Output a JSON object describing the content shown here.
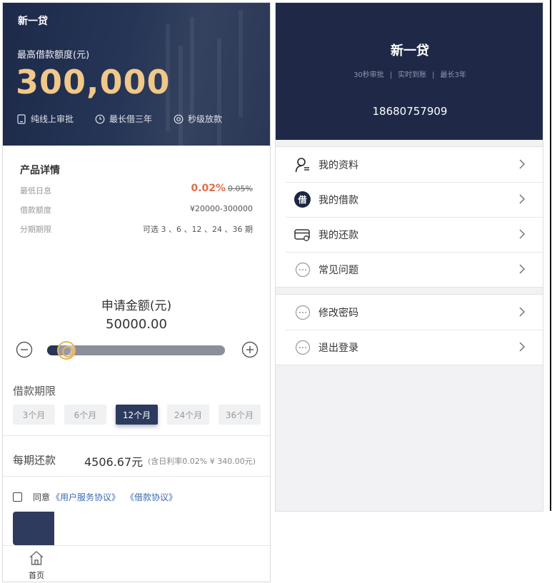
{
  "left": {
    "app_title": "新一贷",
    "limit_label": "最高借款额度(元)",
    "limit_amount": "300,000",
    "features": [
      "纯线上审批",
      "最长借三年",
      "秒级放款"
    ],
    "details": {
      "title": "产品详情",
      "rows": [
        {
          "label": "最低日息",
          "rate": "0.02%",
          "old_rate": "0.05%"
        },
        {
          "label": "借款额度",
          "value": "¥20000-300000"
        },
        {
          "label": "分期期限",
          "value": "可选 3 、6 、12 、24 、36 期"
        }
      ]
    },
    "apply": {
      "label": "申请金额(元)",
      "amount": "50000.00",
      "slider_fraction": 0.11
    },
    "term": {
      "label": "借款期限",
      "options": [
        "3个月",
        "6个月",
        "12个月",
        "24个月",
        "36个月"
      ],
      "selected": "12个月"
    },
    "repayment": {
      "label": "每期还款",
      "amount": "4506.67元",
      "note": "(含日利率0.02% ¥ 340.00元)"
    },
    "agreement": {
      "prefix": "同意",
      "links": [
        "《用户服务协议》",
        "《借款协议》"
      ]
    },
    "tabbar": {
      "home_label": "首页"
    }
  },
  "right": {
    "title": "新一贷",
    "tags": [
      "30秒审批",
      "实时到账",
      "最长3年"
    ],
    "phone": "18680757909",
    "menu_group_1": [
      "我的资料",
      "我的借款",
      "我的还款",
      "常见问题"
    ],
    "menu_group_2": [
      "修改密码",
      "退出登录"
    ],
    "borrow_icon_char": "借"
  },
  "colors": {
    "header_navy": "#1f2947",
    "gold": "#f0c88a",
    "rate_red": "#e06d4a",
    "link_blue": "#3a6bb3",
    "active_term": "#2c3a5e"
  }
}
